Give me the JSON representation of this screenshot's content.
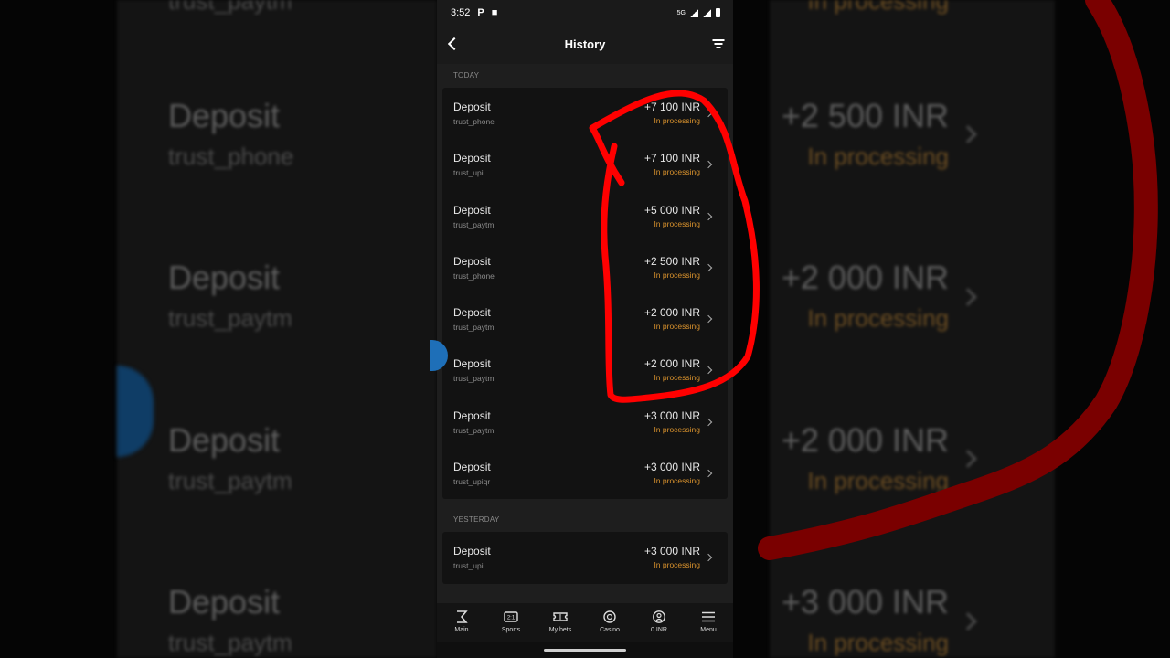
{
  "status_bar": {
    "time": "3:52",
    "icon_p": "P",
    "network": "5G"
  },
  "header": {
    "title": "History"
  },
  "sections": [
    {
      "label": "TODAY",
      "items": [
        {
          "title": "Deposit",
          "method": "trust_phone",
          "amount": "+7 100 INR",
          "status": "In processing"
        },
        {
          "title": "Deposit",
          "method": "trust_upi",
          "amount": "+7 100 INR",
          "status": "In processing"
        },
        {
          "title": "Deposit",
          "method": "trust_paytm",
          "amount": "+5 000 INR",
          "status": "In processing"
        },
        {
          "title": "Deposit",
          "method": "trust_phone",
          "amount": "+2 500 INR",
          "status": "In processing"
        },
        {
          "title": "Deposit",
          "method": "trust_paytm",
          "amount": "+2 000 INR",
          "status": "In processing"
        },
        {
          "title": "Deposit",
          "method": "trust_paytm",
          "amount": "+2 000 INR",
          "status": "In processing"
        },
        {
          "title": "Deposit",
          "method": "trust_paytm",
          "amount": "+3 000 INR",
          "status": "In processing"
        },
        {
          "title": "Deposit",
          "method": "trust_upiqr",
          "amount": "+3 000 INR",
          "status": "In processing"
        }
      ]
    },
    {
      "label": "YESTERDAY",
      "items": [
        {
          "title": "Deposit",
          "method": "trust_upi",
          "amount": "+3 000 INR",
          "status": "In processing"
        }
      ]
    }
  ],
  "bottom_nav": [
    {
      "label": "Main",
      "icon": "main-icon"
    },
    {
      "label": "Sports",
      "icon": "sports-icon"
    },
    {
      "label": "My bets",
      "icon": "ticket-icon"
    },
    {
      "label": "Casino",
      "icon": "casino-chip-icon"
    },
    {
      "label": "0 INR",
      "icon": "user-icon"
    },
    {
      "label": "Menu",
      "icon": "hamburger-icon"
    }
  ],
  "background_left": [
    {
      "title": "Deposit",
      "method": "trust_phone"
    },
    {
      "title": "Deposit",
      "method": "trust_paytm"
    },
    {
      "title": "Deposit",
      "method": "trust_paytm"
    },
    {
      "title": "Deposit",
      "method": "trust_paytm"
    }
  ],
  "background_right": [
    {
      "amount": "+2 500 INR",
      "status": "In processing"
    },
    {
      "amount": "+2 000 INR",
      "status": "In processing"
    },
    {
      "amount": "+2 000 INR",
      "status": "In processing"
    },
    {
      "amount": "+3 000 INR",
      "status": "In processing"
    }
  ],
  "colors": {
    "status_accent": "#d9922d",
    "annotation": "#ff0000",
    "bubble": "#1e6fb8"
  }
}
